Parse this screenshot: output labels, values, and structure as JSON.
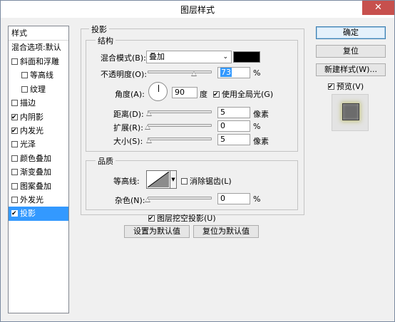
{
  "window": {
    "title": "图层样式",
    "close_glyph": "✕"
  },
  "stylelist": {
    "header": "样式",
    "blending": "混合选项:默认",
    "items": [
      {
        "label": "斜面和浮雕",
        "checked": false,
        "indent": false
      },
      {
        "label": "等高线",
        "checked": false,
        "indent": true
      },
      {
        "label": "纹理",
        "checked": false,
        "indent": true
      },
      {
        "label": "描边",
        "checked": false,
        "indent": false
      },
      {
        "label": "内阴影",
        "checked": true,
        "indent": false
      },
      {
        "label": "内发光",
        "checked": true,
        "indent": false
      },
      {
        "label": "光泽",
        "checked": false,
        "indent": false
      },
      {
        "label": "颜色叠加",
        "checked": false,
        "indent": false
      },
      {
        "label": "渐变叠加",
        "checked": false,
        "indent": false
      },
      {
        "label": "图案叠加",
        "checked": false,
        "indent": false
      },
      {
        "label": "外发光",
        "checked": false,
        "indent": false
      },
      {
        "label": "投影",
        "checked": true,
        "indent": false,
        "selected": true
      }
    ]
  },
  "drop_shadow": {
    "title": "投影",
    "structure": {
      "title": "结构",
      "blend_mode_label": "混合模式(B):",
      "blend_mode_value": "叠加",
      "blend_color": "#000000",
      "opacity_label": "不透明度(O):",
      "opacity_value": "73",
      "percent": "%",
      "angle_label": "角度(A):",
      "angle_value": "90",
      "degree_unit": "度",
      "global_light_label": "使用全局光(G)",
      "global_light_checked": true,
      "distance_label": "距离(D):",
      "distance_value": "5",
      "spread_label": "扩展(R):",
      "spread_value": "0",
      "size_label": "大小(S):",
      "size_value": "5",
      "px_unit": "像素"
    },
    "quality": {
      "title": "品质",
      "contour_label": "等高线:",
      "antialias_label": "消除锯齿(L)",
      "antialias_checked": false,
      "noise_label": "杂色(N):",
      "noise_value": "0",
      "percent": "%"
    },
    "knockout_label": "图层挖空投影(U)",
    "knockout_checked": true,
    "make_default_label": "设置为默认值",
    "reset_default_label": "复位为默认值"
  },
  "buttons": {
    "ok": "确定",
    "reset": "复位",
    "new_style": "新建样式(W)...",
    "preview_label": "预览(V)",
    "preview_checked": true
  },
  "colors": {
    "selection": "#3399ff",
    "close": "#c7504d"
  }
}
